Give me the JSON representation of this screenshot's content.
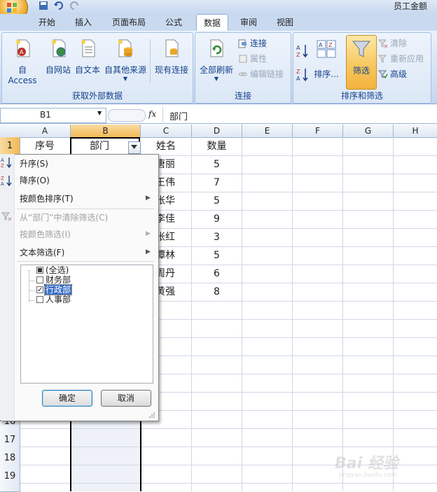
{
  "window": {
    "title": "员工金额"
  },
  "tabs": [
    "开始",
    "插入",
    "页面布局",
    "公式",
    "数据",
    "审阅",
    "视图"
  ],
  "active_tab": "数据",
  "ribbon": {
    "groups": [
      {
        "label": "获取外部数据",
        "buttons": [
          "自 Access",
          "自网站",
          "自文本",
          "自其他来源",
          "现有连接"
        ]
      },
      {
        "label": "连接",
        "big_button": "全部刷新",
        "small_buttons": [
          "连接",
          "属性",
          "编辑链接"
        ]
      },
      {
        "label": "排序和筛选",
        "sort_button": "排序...",
        "filter_button": "筛选",
        "small_buttons": [
          "清除",
          "重新应用",
          "高级"
        ]
      }
    ]
  },
  "formula_bar": {
    "name_box": "B1",
    "fx": "fx",
    "value": "部门"
  },
  "columns": [
    "A",
    "B",
    "C",
    "D",
    "E",
    "F",
    "G",
    "H"
  ],
  "rows": [
    "1",
    "16",
    "17",
    "18",
    "19"
  ],
  "header_row": {
    "A": "序号",
    "B": "部门",
    "C": "姓名",
    "D": "数量"
  },
  "names": [
    "唐丽",
    "王伟",
    "张华",
    "李佳",
    "张红",
    "谭林",
    "周丹",
    "黄强"
  ],
  "quantities": [
    "5",
    "7",
    "5",
    "9",
    "3",
    "5",
    "6",
    "8"
  ],
  "filter_menu": {
    "items": [
      {
        "label": "升序(S)",
        "enabled": true
      },
      {
        "label": "降序(O)",
        "enabled": true
      },
      {
        "label": "按颜色排序(T)",
        "enabled": true,
        "submenu": true
      },
      {
        "label": "从“部门”中清除筛选(C)",
        "enabled": false
      },
      {
        "label": "按颜色筛选(I)",
        "enabled": false,
        "submenu": true
      },
      {
        "label": "文本筛选(F)",
        "enabled": true,
        "submenu": true
      }
    ],
    "list": [
      {
        "label": "(全选)",
        "state": "partial"
      },
      {
        "label": "财务部",
        "state": "unchecked"
      },
      {
        "label": "行政部",
        "state": "checked"
      },
      {
        "label": "人事部",
        "state": "unchecked"
      }
    ],
    "ok_label": "确定",
    "cancel_label": "取消"
  },
  "watermark": {
    "text": "Bai 经验",
    "sub": "jingyan.baidu.com"
  }
}
